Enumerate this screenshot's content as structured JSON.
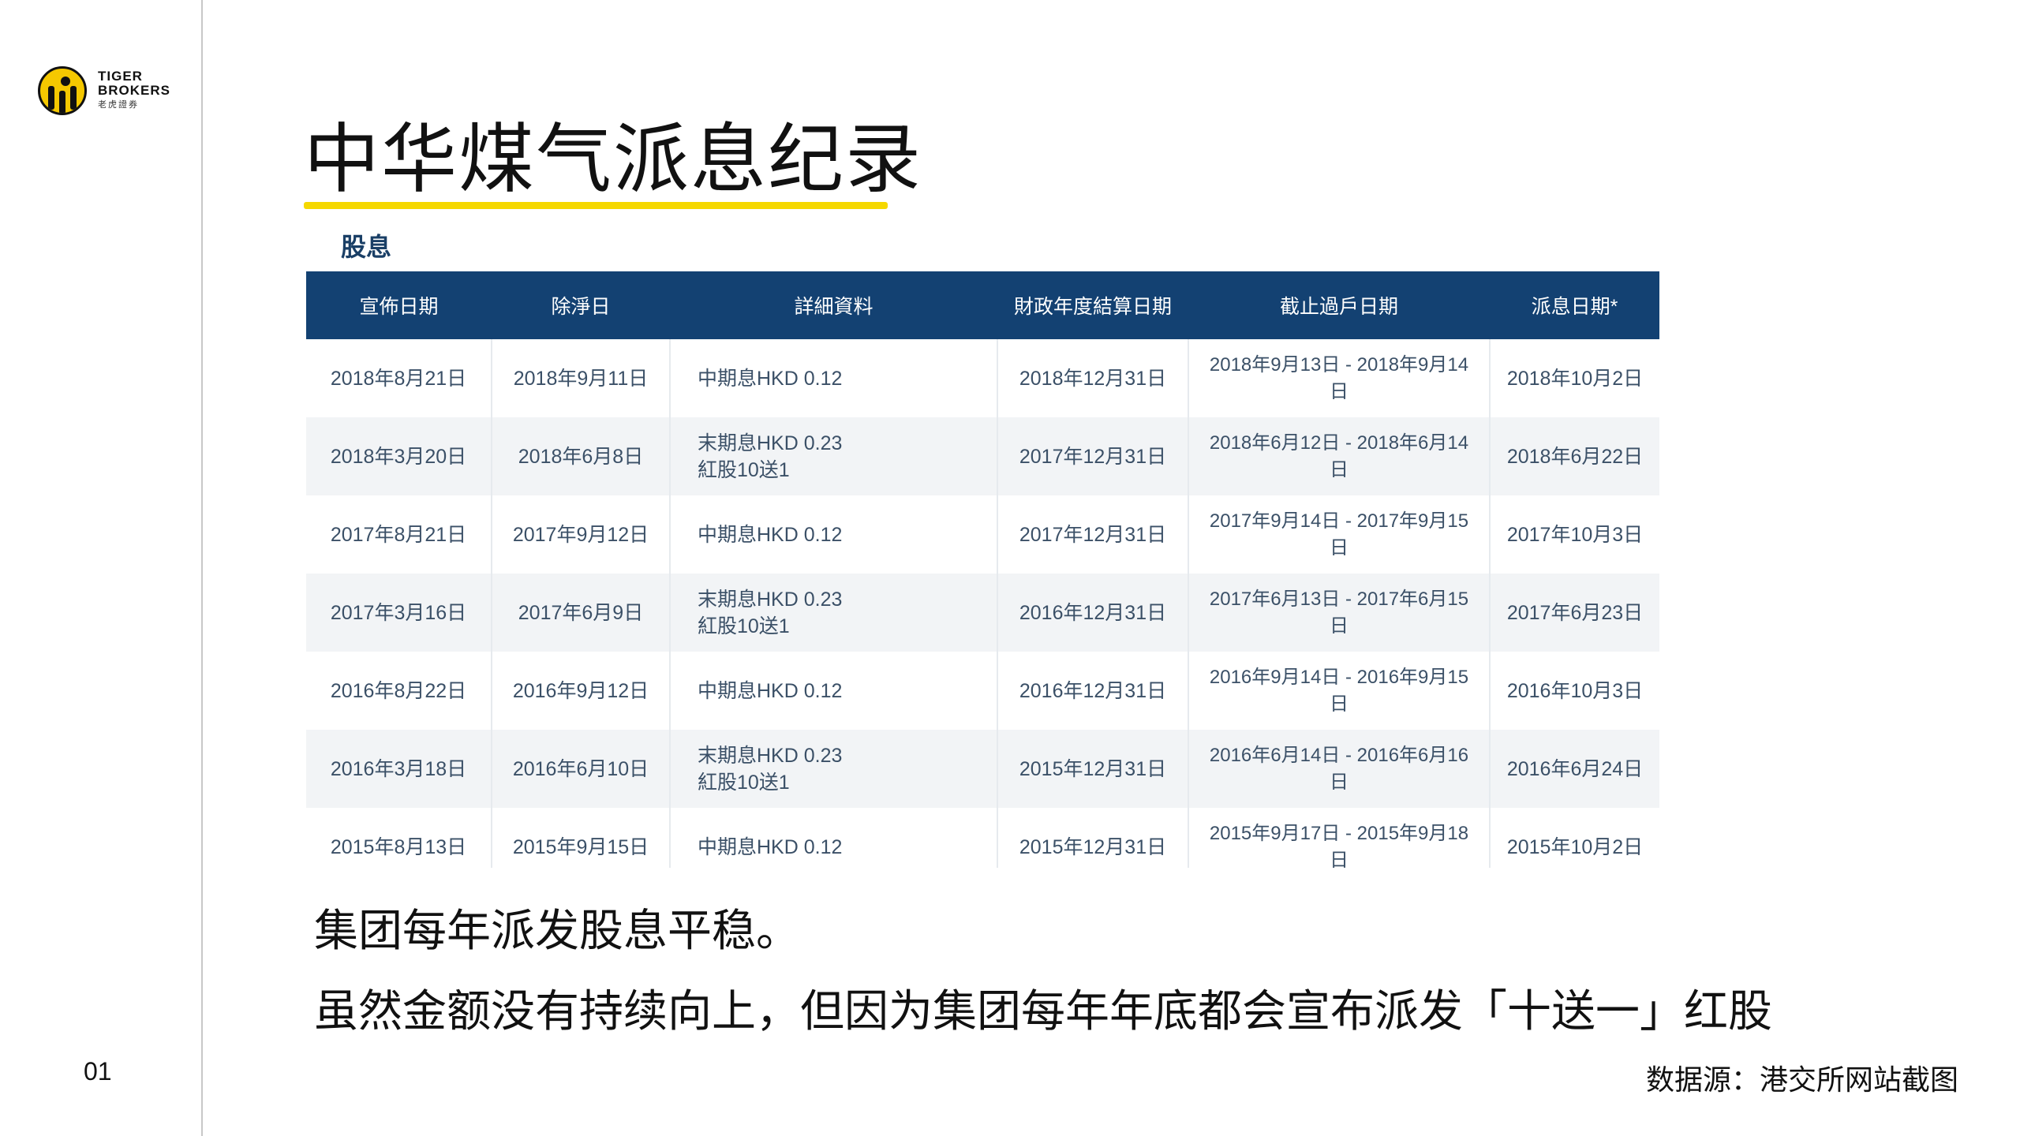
{
  "logo": {
    "line1": "TIGER",
    "line2": "BROKERS",
    "line3": "老虎證券"
  },
  "title": "中华煤气派息纪录",
  "section_label": "股息",
  "table": {
    "headers": [
      "宣佈日期",
      "除淨日",
      "詳細資料",
      "財政年度結算日期",
      "截止過戶日期",
      "派息日期*"
    ],
    "rows": [
      {
        "announce": "2018年8月21日",
        "exdate": "2018年9月11日",
        "detail1": "中期息HKD 0.12",
        "detail2": "",
        "fiscal": "2018年12月31日",
        "period1": "2018年9月13日 - 2018年9月14",
        "period2": "日",
        "paydate": "2018年10月2日"
      },
      {
        "announce": "2018年3月20日",
        "exdate": "2018年6月8日",
        "detail1": "末期息HKD 0.23",
        "detail2": "紅股10送1",
        "fiscal": "2017年12月31日",
        "period1": "2018年6月12日 - 2018年6月14",
        "period2": "日",
        "paydate": "2018年6月22日"
      },
      {
        "announce": "2017年8月21日",
        "exdate": "2017年9月12日",
        "detail1": "中期息HKD 0.12",
        "detail2": "",
        "fiscal": "2017年12月31日",
        "period1": "2017年9月14日 - 2017年9月15",
        "period2": "日",
        "paydate": "2017年10月3日"
      },
      {
        "announce": "2017年3月16日",
        "exdate": "2017年6月9日",
        "detail1": "末期息HKD 0.23",
        "detail2": "紅股10送1",
        "fiscal": "2016年12月31日",
        "period1": "2017年6月13日 - 2017年6月15",
        "period2": "日",
        "paydate": "2017年6月23日"
      },
      {
        "announce": "2016年8月22日",
        "exdate": "2016年9月12日",
        "detail1": "中期息HKD 0.12",
        "detail2": "",
        "fiscal": "2016年12月31日",
        "period1": "2016年9月14日 - 2016年9月15",
        "period2": "日",
        "paydate": "2016年10月3日"
      },
      {
        "announce": "2016年3月18日",
        "exdate": "2016年6月10日",
        "detail1": "末期息HKD 0.23",
        "detail2": "紅股10送1",
        "fiscal": "2015年12月31日",
        "period1": "2016年6月14日 - 2016年6月16",
        "period2": "日",
        "paydate": "2016年6月24日"
      },
      {
        "announce": "2015年8月13日",
        "exdate": "2015年9月15日",
        "detail1": "中期息HKD 0.12",
        "detail2": "",
        "fiscal": "2015年12月31日",
        "period1": "2015年9月17日 - 2015年9月18",
        "period2": "日",
        "paydate": "2015年10月2日"
      }
    ]
  },
  "notes": {
    "line1": "集团每年派发股息平稳。",
    "line2": "虽然金额没有持续向上，但因为集团每年年底都会宣布派发「十送一」红股"
  },
  "source": "数据源：港交所网站截图",
  "page_number": "01",
  "colors": {
    "header_bg": "#134172",
    "accent_yellow": "#f5d800",
    "section_label": "#1a3f66"
  }
}
